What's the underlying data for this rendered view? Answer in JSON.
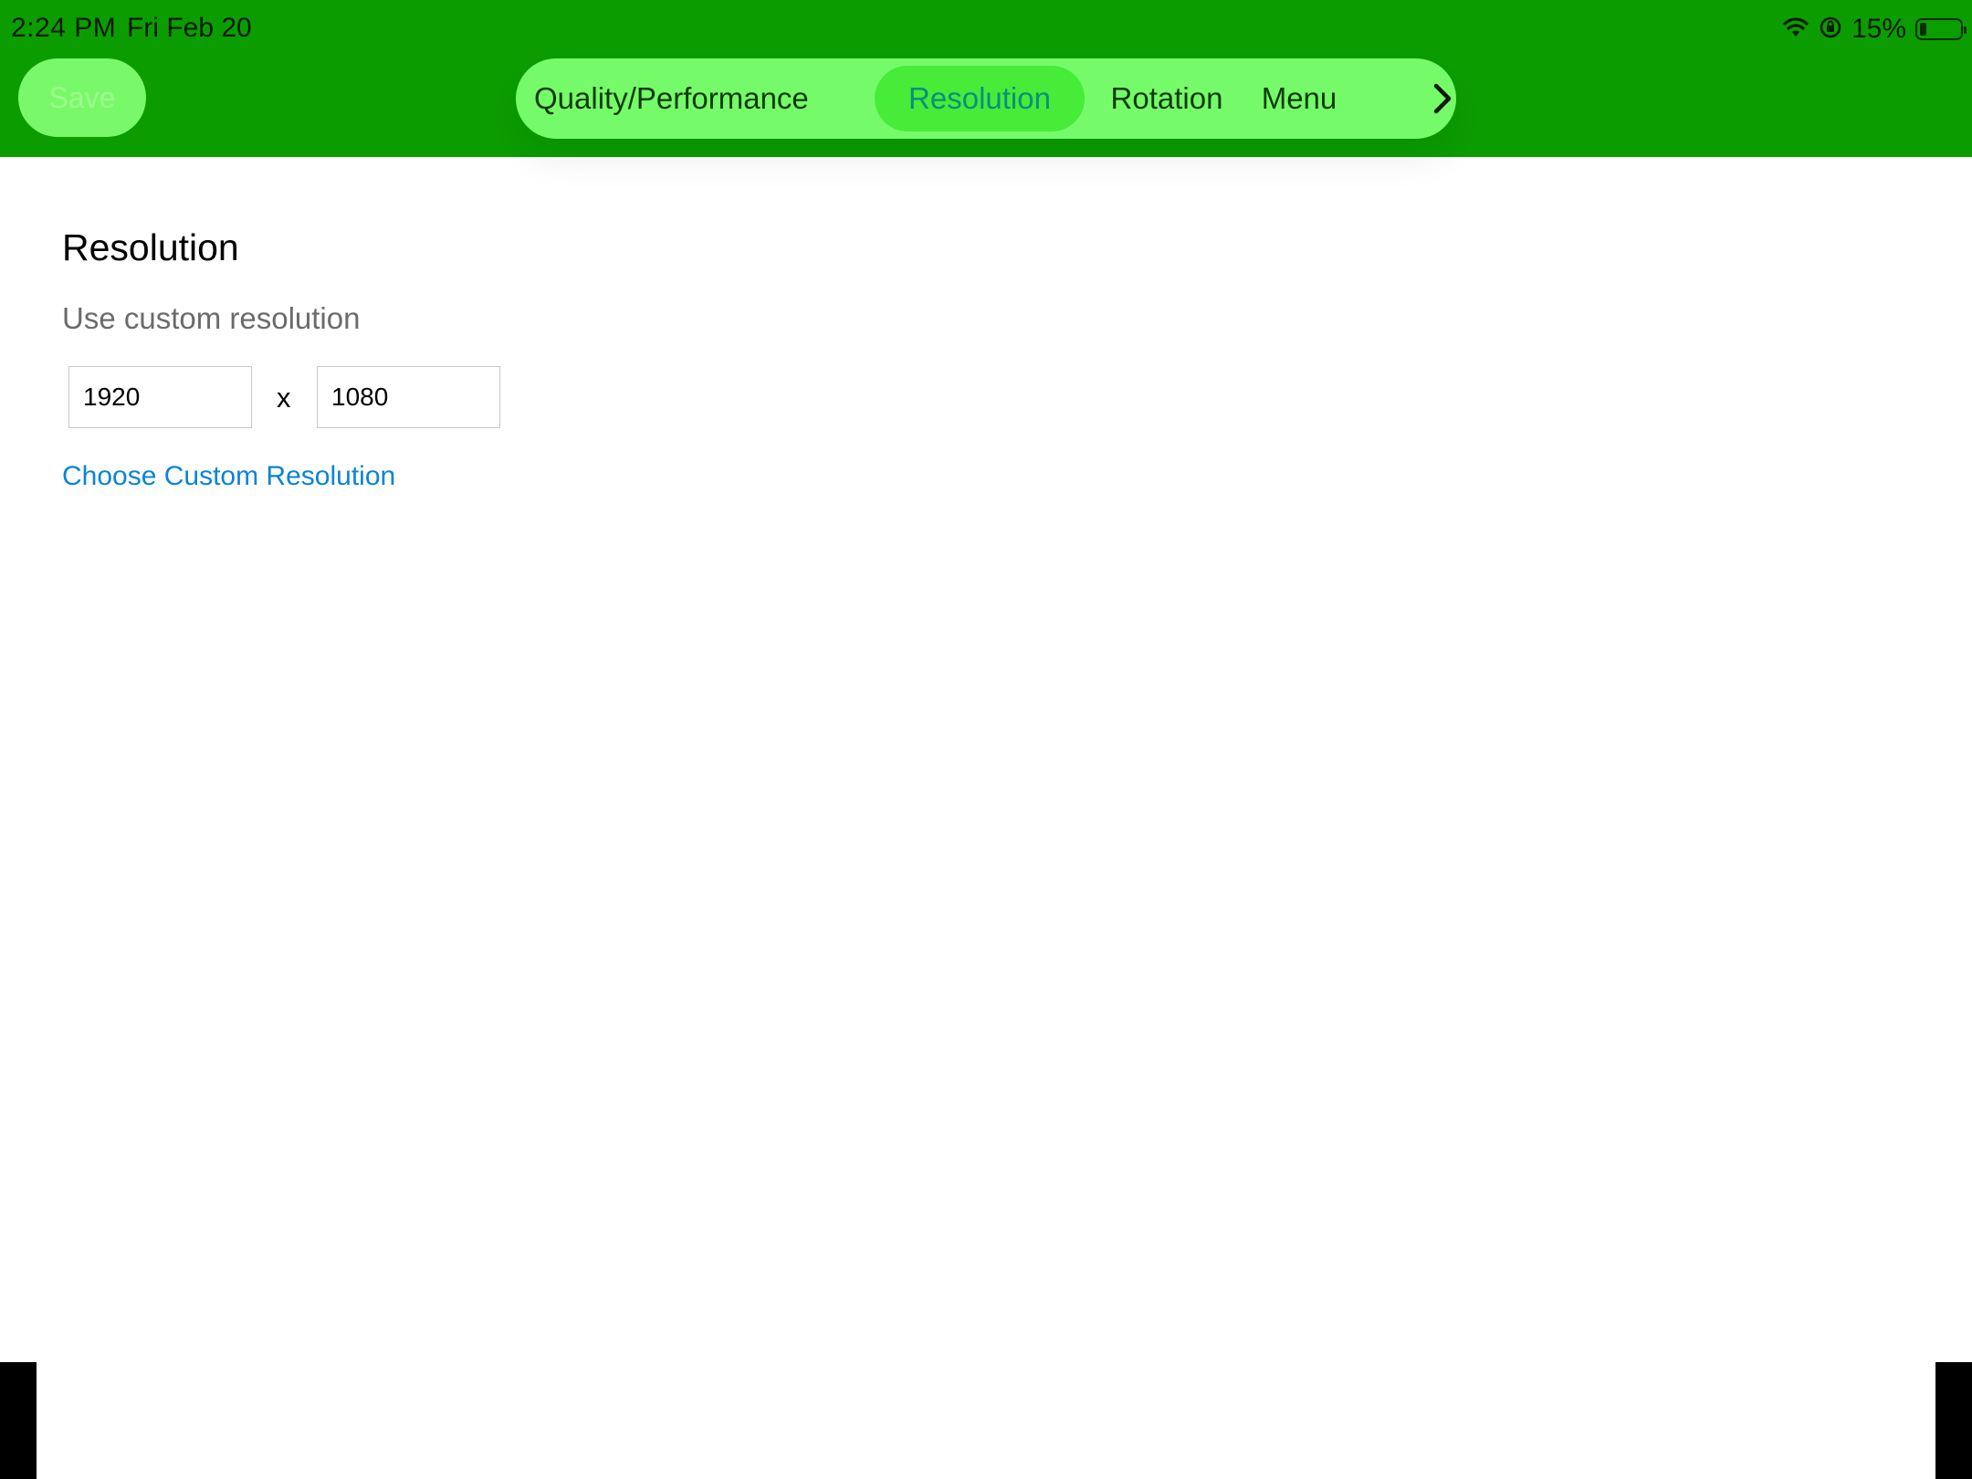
{
  "status_bar": {
    "time": "2:24 PM",
    "date": "Fri Feb 20",
    "battery_percent": "15%",
    "battery_level": 0.15,
    "icons": [
      "wifi-icon",
      "rotation-lock-icon",
      "battery-icon"
    ]
  },
  "toolbar": {
    "save_label": "Save"
  },
  "tabs": [
    {
      "label": "Quality/Performance",
      "active": false
    },
    {
      "label": "Resolution",
      "active": true
    },
    {
      "label": "Rotation",
      "active": false
    },
    {
      "label": "Menu",
      "active": false
    }
  ],
  "tabs_next_icon": "chevron-right-icon",
  "content": {
    "title": "Resolution",
    "subtitle": "Use custom resolution",
    "width_value": "1920",
    "separator": "x",
    "height_value": "1080",
    "link_label": "Choose Custom Resolution"
  },
  "colors": {
    "header_bg": "#0b9d00",
    "tab_bar_bg": "#75fb69",
    "tab_active_bg": "#46ec38",
    "tab_active_text": "#0a8f7c",
    "link": "#0a84d6"
  }
}
